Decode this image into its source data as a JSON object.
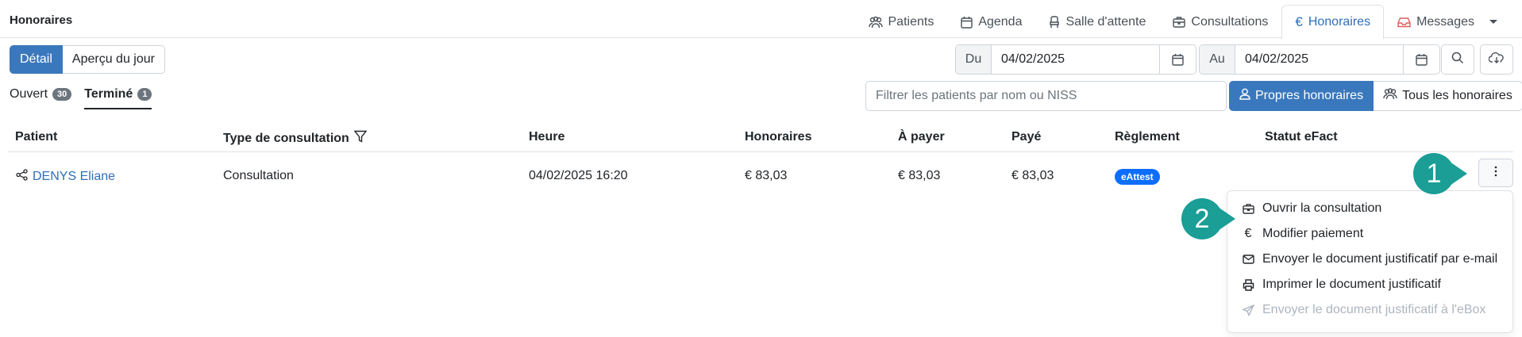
{
  "app": {
    "title": "Honoraires"
  },
  "nav": {
    "tabs": [
      {
        "label": "Patients",
        "icon": "users-icon"
      },
      {
        "label": "Agenda",
        "icon": "calendar-icon"
      },
      {
        "label": "Salle d'attente",
        "icon": "chair-icon"
      },
      {
        "label": "Consultations",
        "icon": "briefcase-icon"
      },
      {
        "label": "Honoraires",
        "icon": "euro-icon",
        "active": true
      },
      {
        "label": "Messages",
        "icon": "inbox-icon"
      }
    ]
  },
  "view_toggle": {
    "detail": "Détail",
    "day_overview": "Aperçu du jour"
  },
  "date_range": {
    "from_label": "Du",
    "from_value": "04/02/2025",
    "to_label": "Au",
    "to_value": "04/02/2025"
  },
  "status_tabs": {
    "open": {
      "label": "Ouvert",
      "count": "30"
    },
    "done": {
      "label": "Terminé",
      "count": "1"
    }
  },
  "filter": {
    "placeholder": "Filtrer les patients par nom ou NISS"
  },
  "scope": {
    "own": "Propres honoraires",
    "all": "Tous les honoraires"
  },
  "table": {
    "headers": {
      "patient": "Patient",
      "type": "Type de consultation",
      "time": "Heure",
      "fees": "Honoraires",
      "to_pay": "À payer",
      "paid": "Payé",
      "settlement": "Règlement",
      "efact": "Statut eFact"
    },
    "rows": [
      {
        "patient": "DENYS Eliane",
        "type": "Consultation",
        "time": "04/02/2025 16:20",
        "fees": "€ 83,03",
        "to_pay": "€ 83,03",
        "paid": "€ 83,03",
        "settlement": "eAttest",
        "efact": ""
      }
    ]
  },
  "row_menu": {
    "items": [
      {
        "label": "Ouvrir la consultation",
        "icon": "briefcase-icon"
      },
      {
        "label": "Modifier paiement",
        "icon": "euro-icon"
      },
      {
        "label": "Envoyer le document justificatif par e-mail",
        "icon": "envelope-icon"
      },
      {
        "label": "Imprimer le document justificatif",
        "icon": "printer-icon"
      },
      {
        "label": "Envoyer le document justificatif à l'eBox",
        "icon": "send-icon",
        "disabled": true
      }
    ]
  },
  "callouts": {
    "one": "1",
    "two": "2"
  },
  "colors": {
    "primary": "#3a78bd",
    "link": "#2f6fb7",
    "callout": "#1a9e96",
    "badge": "#0d6efd"
  }
}
